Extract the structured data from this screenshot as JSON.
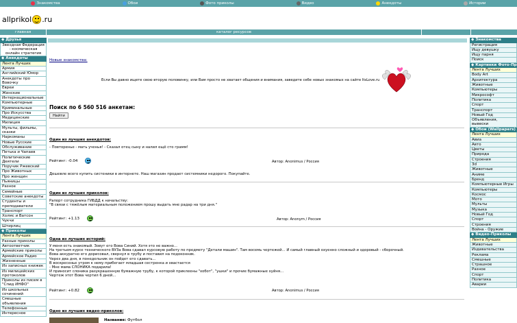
{
  "topnav": [
    {
      "label": "Знакомства",
      "icon": "heart-icon",
      "color": "#e8324a"
    },
    {
      "label": "Обои",
      "icon": "picture-icon",
      "color": "#4aa0e0"
    },
    {
      "label": "Фото приколы",
      "icon": "camera-icon",
      "color": "#555555"
    },
    {
      "label": "Видео",
      "icon": "video-icon",
      "color": "#666666"
    },
    {
      "label": "Анекдоты",
      "icon": "smiley-icon",
      "color": "#ffd800"
    },
    {
      "label": "Истории",
      "icon": "book-icon",
      "color": "#aaaaaa"
    }
  ],
  "logo": {
    "left": "allprikol",
    "right": ".ru"
  },
  "mainbar": {
    "home": "главная",
    "catalog": "каталог ресурсов"
  },
  "left": {
    "friends": {
      "title": "◆ Друзья",
      "items": [
        "Звездная Федерация - космическая онлайн стратегия"
      ]
    },
    "jokes": {
      "title": "◆ Анекдоты",
      "items": [
        "Лента Лучших",
        "Армия",
        "Английский Юмор",
        "Анекдоты про Вовочку",
        "Евреи",
        "Женские",
        "Интернациональные",
        "Компьютерные",
        "Криминальные",
        "Про Искусства",
        "Медицинские",
        "Милиция",
        "Мульты, фильмы, сказки",
        "Наркоманы",
        "Новые Русские",
        "Обслуживание",
        "Петька и Чапаев",
        "Политические Деятели",
        "Поручик Ржевский",
        "Про Животных",
        "Про женщин",
        "Пьяницы",
        "Разное",
        "Семейные",
        "Советские анекдоты",
        "Студенты и преподаватели",
        "Транспорт",
        "Холмс и Ватсон",
        "Чукчи",
        "Штирлиц"
      ]
    },
    "pranks": {
      "title": "◆ Приколы",
      "items": [
        "Лента Лучших",
        "Разные приколы",
        "Автоответчик",
        "Армейские приколы",
        "Армейское Радио",
        "Жизненные",
        "Из записных книжек",
        "Из милицейских протоколов",
        "Приколы из писем в \"Спид ИНФО\"",
        "Из школьных сочинений",
        "Смешные объявления",
        "Телефонные",
        "Интересное"
      ]
    }
  },
  "right": {
    "dating": {
      "title": "◆ Знакомства",
      "items": [
        "Регистрация",
        "Ищу девушку",
        "Ищу парня",
        "Поиск"
      ]
    },
    "pictures": {
      "title": "◆ Картинки Фото-Приколы",
      "items": [
        "Лента Лучших",
        "Body Art",
        "Архитектура",
        "Животные",
        "Компьютеры",
        "Микрософт",
        "Политика",
        "Спорт",
        "Транспорт",
        "Новый Год",
        "Объявления, вывески"
      ]
    },
    "wallpapers": {
      "title": "◆ Обои (Wallpapers)",
      "items": [
        "Лента Лучших",
        "Авиа",
        "Авто",
        "Цветы",
        "Природа",
        "Строения",
        "3d",
        "Животные",
        "Аниме",
        "Бренд",
        "Компьютерные Игры",
        "Компьютеры",
        "Космос",
        "Мото",
        "Мульты",
        "Музыка",
        "Новый Год",
        "Спорт",
        "Строения",
        "Война - Оружие"
      ]
    },
    "videos": {
      "title": "◆ Видео-Приколы",
      "items": [
        "Лента Лучших",
        "Животные",
        "Издевательства",
        "Реклама",
        "Смешные",
        "Страшное",
        "Разное",
        "Спорт",
        "Политика",
        "Аварии"
      ]
    }
  },
  "main": {
    "new_link": "Новые знакомства:",
    "intro": "Если Вы давно ищете свою вторую половинку, или Вам просто не хватает общения и внимания, заведите себе новых знакомых на сайте ItsLove.ru",
    "search_title": "Поиск по 6 560 516 анкетам:",
    "find_button": "Найти",
    "blocks": [
      {
        "title": "Один из лучших анекдотов:",
        "lines": [
          "- Повторенье - мать ученья! - Сказал отец сыну и налил ещё сто грамм!"
        ],
        "rating": "Рейтинг: -0.04",
        "author": "Автор: Anonimus / Россия",
        "promo": "Дешевле всего купить систеники в интернете. Наш магазин продает системники недорого. Покупайте."
      },
      {
        "title": "Один из лучших приколов:",
        "lines": [
          "Рапорт сотрудника ГИБДД к начальству:",
          "\"В связи с тяжёлым материальным положением прошу выдать мне радар на три дня.\""
        ],
        "rating": "Рейтинг: +1.13",
        "author": "Автор: Anonym / Россия"
      },
      {
        "title": "Одна из лучших историй:",
        "lines": [
          "У меня есть знакомый. Зовут его Вова Синий. Хотя это не важно...",
          "На третьем курсе технического ВУЗа Вова сдавал курсовую работу по предмету \"Детали машин\". Там восемь чертежей... И самый главный охуенно сложный и здоровый - сборочный.",
          "Вова аккуратно его дорисовал, свернул в трубу и поставил на подоконник.",
          "Через два дня, в понедельник он пойдет его сдавать...",
          "В воскресенье утром к нему прибегает младшая сестренка и хвастается",
          "- Мне мама СЛОНИКА подарила!",
          "И приносит слоника разукрашенную бумажную трубу, к которой приклеены \"хобот\", \"ушки\" и прочие бумажные хуйня...",
          "Чертеж этот Вова чертил 6 дней..."
        ],
        "rating": "Рейтинг: +0.82",
        "author": "Автор: Anonimus / Россия"
      }
    ],
    "video_title": "Одно из лучших видео-приколов:",
    "video_name_label": "Название:",
    "video_name": "Футбол"
  }
}
